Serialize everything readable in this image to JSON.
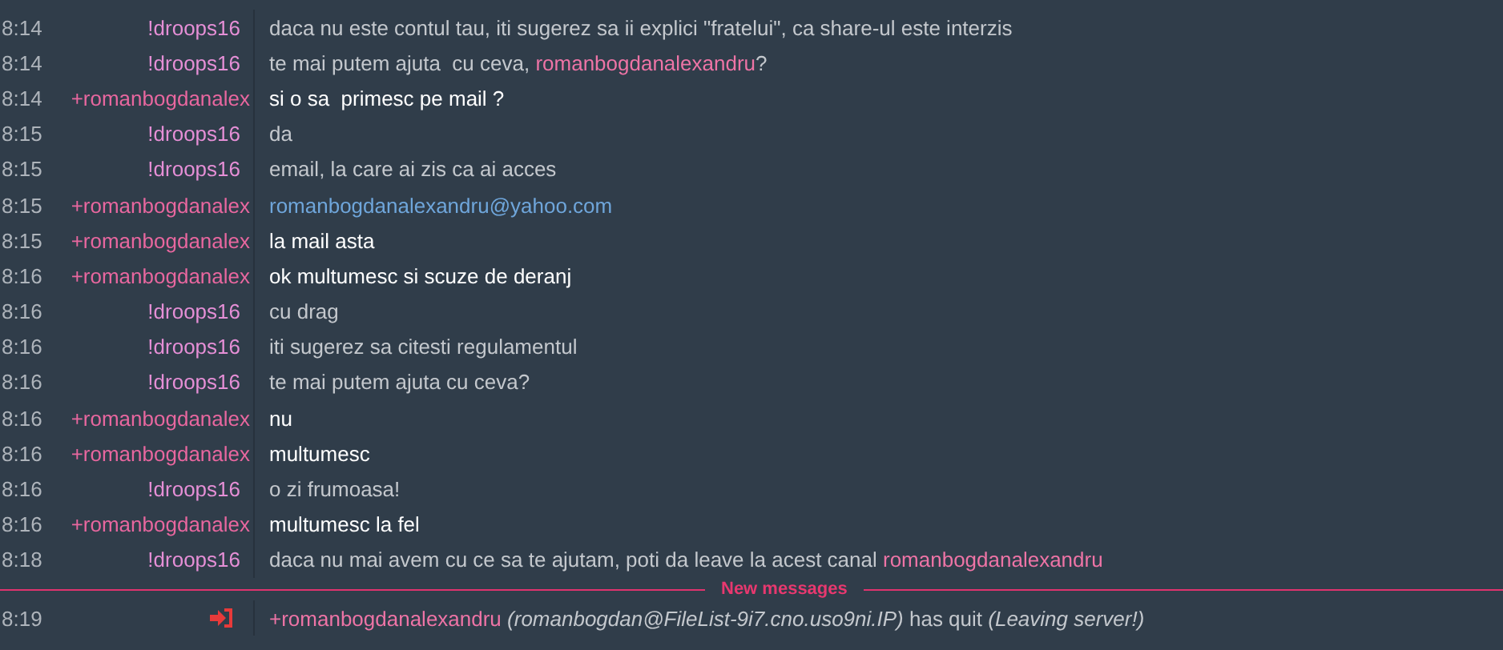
{
  "messages": [
    {
      "time": "8:14",
      "nick": "!droops16",
      "kind": "op",
      "parts": [
        {
          "kind": "plain",
          "text": "daca nu este contul tau, iti sugerez sa ii explici \"fratelui\", ca share-ul este interzis"
        }
      ]
    },
    {
      "time": "8:14",
      "nick": "!droops16",
      "kind": "op",
      "parts": [
        {
          "kind": "plain",
          "text": "te mai putem ajuta  cu ceva, "
        },
        {
          "kind": "mention",
          "text": "romanbogdanalexandru"
        },
        {
          "kind": "plain",
          "text": "?"
        }
      ]
    },
    {
      "time": "8:14",
      "nick": "+romanbogdanalex",
      "kind": "voice",
      "parts": [
        {
          "kind": "plain",
          "text": "si o sa  primesc pe mail ?"
        }
      ]
    },
    {
      "time": "8:15",
      "nick": "!droops16",
      "kind": "op",
      "parts": [
        {
          "kind": "plain",
          "text": "da"
        }
      ]
    },
    {
      "time": "8:15",
      "nick": "!droops16",
      "kind": "op",
      "parts": [
        {
          "kind": "plain",
          "text": "email, la care ai zis ca ai acces"
        }
      ]
    },
    {
      "time": "8:15",
      "nick": "+romanbogdanalex",
      "kind": "voice",
      "parts": [
        {
          "kind": "link",
          "text": "romanbogdanalexandru@yahoo.com"
        }
      ]
    },
    {
      "time": "8:15",
      "nick": "+romanbogdanalex",
      "kind": "voice",
      "parts": [
        {
          "kind": "plain",
          "text": "la mail asta"
        }
      ]
    },
    {
      "time": "8:16",
      "nick": "+romanbogdanalex",
      "kind": "voice",
      "parts": [
        {
          "kind": "plain",
          "text": "ok multumesc si scuze de deranj"
        }
      ]
    },
    {
      "time": "8:16",
      "nick": "!droops16",
      "kind": "op",
      "parts": [
        {
          "kind": "plain",
          "text": "cu drag"
        }
      ]
    },
    {
      "time": "8:16",
      "nick": "!droops16",
      "kind": "op",
      "parts": [
        {
          "kind": "plain",
          "text": "iti sugerez sa citesti regulamentul"
        }
      ]
    },
    {
      "time": "8:16",
      "nick": "!droops16",
      "kind": "op",
      "parts": [
        {
          "kind": "plain",
          "text": "te mai putem ajuta cu ceva?"
        }
      ]
    },
    {
      "time": "8:16",
      "nick": "+romanbogdanalex",
      "kind": "voice",
      "parts": [
        {
          "kind": "plain",
          "text": "nu"
        }
      ]
    },
    {
      "time": "8:16",
      "nick": "+romanbogdanalex",
      "kind": "voice",
      "parts": [
        {
          "kind": "plain",
          "text": "multumesc"
        }
      ]
    },
    {
      "time": "8:16",
      "nick": "!droops16",
      "kind": "op",
      "parts": [
        {
          "kind": "plain",
          "text": "o zi frumoasa!"
        }
      ]
    },
    {
      "time": "8:16",
      "nick": "+romanbogdanalex",
      "kind": "voice",
      "parts": [
        {
          "kind": "plain",
          "text": "multumesc la fel"
        }
      ]
    },
    {
      "time": "8:18",
      "nick": "!droops16",
      "kind": "op",
      "parts": [
        {
          "kind": "plain",
          "text": "daca nu mai avem cu ce sa te ajutam, poti da leave la acest canal "
        },
        {
          "kind": "mention",
          "text": "romanbogdanalexandru"
        }
      ]
    }
  ],
  "new_messages_divider": "New messages",
  "events": [
    {
      "time": "8:19",
      "kind": "quit",
      "nick": "+romanbogdanalexandru",
      "text": "*(romanbogdan@FileList-9i7.cno.uso9ni.IP)* has quit *(Leaving server!)*"
    }
  ]
}
